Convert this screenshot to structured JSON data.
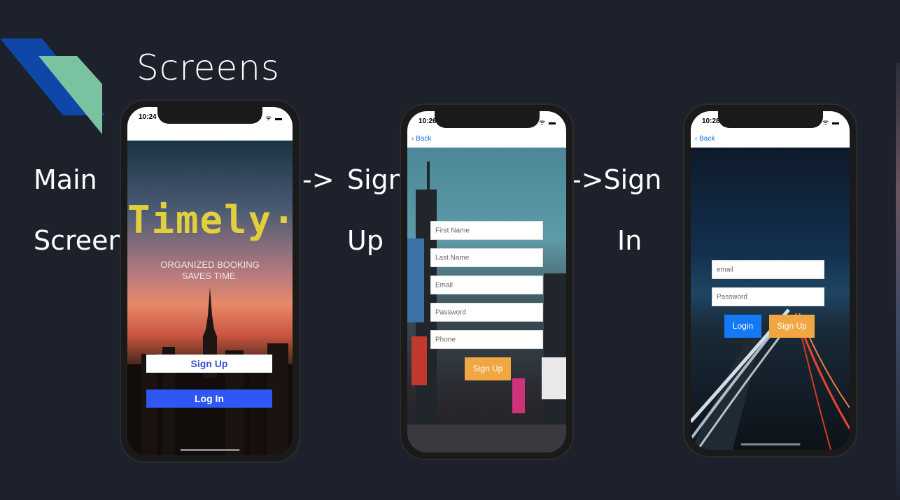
{
  "slide": {
    "title": "Screens"
  },
  "labels": {
    "main_line1": "Main",
    "main_line2": "Screen",
    "arrow1": "->",
    "signup_line1": "Sign",
    "signup_line2": "Up",
    "arrow2": "->Sign",
    "signin_line2": "In"
  },
  "phone1": {
    "time": "10:24",
    "status_icons": "···· ᯤ ▬",
    "logo": "Timely·",
    "tagline_line1": "ORGANIZED BOOKING",
    "tagline_line2": "SAVES TIME.",
    "signup_button": "Sign Up",
    "login_button": "Log In"
  },
  "phone2": {
    "time": "10:26",
    "status_icons": "···· ᯤ ▬",
    "back_label": "Back",
    "fields": [
      {
        "placeholder": "First Name"
      },
      {
        "placeholder": "Last Name"
      },
      {
        "placeholder": "Email"
      },
      {
        "placeholder": "Password"
      },
      {
        "placeholder": "Phone"
      }
    ],
    "signup_button": "Sign Up"
  },
  "phone3": {
    "time": "10:28",
    "status_icons": "···· ᯤ ▬",
    "back_label": "Back",
    "fields": [
      {
        "placeholder": "email"
      },
      {
        "placeholder": "Password"
      }
    ],
    "login_button": "Login",
    "signup_button": "Sign Up"
  },
  "colors": {
    "background": "#1c212b",
    "deco_blue": "#0e47a8",
    "deco_green": "#7ac2a0",
    "signup_text": "#3b52d6",
    "login_blue": "#2f57f5",
    "orange_button": "#f0a742",
    "ios_blue_button": "#1479f5",
    "logo_yellow": "#e2cf3e"
  }
}
